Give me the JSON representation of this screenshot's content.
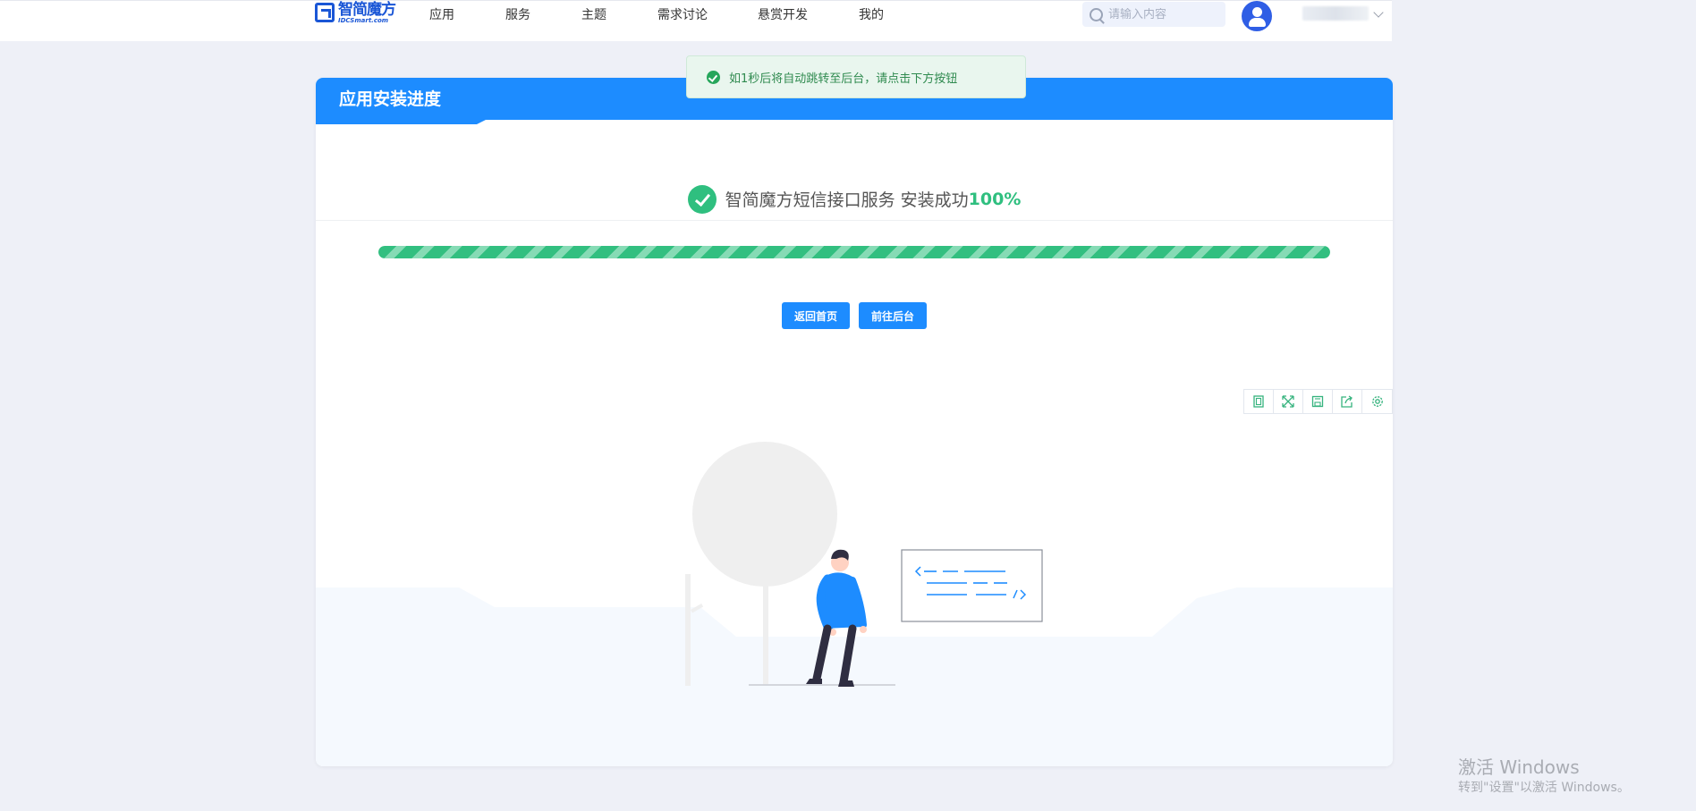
{
  "brand": {
    "logo_cn": "智简魔方",
    "logo_en": "IDCSmart.com",
    "primary_color": "#1d8cff",
    "success_color": "#2fbf7f"
  },
  "nav": {
    "items": [
      {
        "label": "应用"
      },
      {
        "label": "服务"
      },
      {
        "label": "主题"
      },
      {
        "label": "需求讨论"
      },
      {
        "label": "悬赏开发"
      },
      {
        "label": "我的"
      }
    ]
  },
  "search": {
    "placeholder": "请输入内容",
    "icon": "search-icon"
  },
  "user": {
    "avatar_icon": "user-avatar-icon",
    "menu_icon": "chevron-down-icon"
  },
  "toast": {
    "message": "如1秒后将自动跳转至后台，请点击下方按钮",
    "icon": "success-check-icon"
  },
  "card": {
    "title": "应用安装进度",
    "status_text": "智简魔方短信接口服务 安装成功",
    "status_percent": "100%",
    "progress_fraction": 1.0,
    "buttons": {
      "home_label": "返回首页",
      "backend_label": "前往后台"
    },
    "toolbox": [
      {
        "icon": "view-icon"
      },
      {
        "icon": "fullscreen-icon"
      },
      {
        "icon": "save-icon"
      },
      {
        "icon": "share-icon"
      },
      {
        "icon": "settings-icon"
      }
    ]
  },
  "watermark": {
    "title": "激活 Windows",
    "subtitle": "转到\"设置\"以激活 Windows。"
  }
}
